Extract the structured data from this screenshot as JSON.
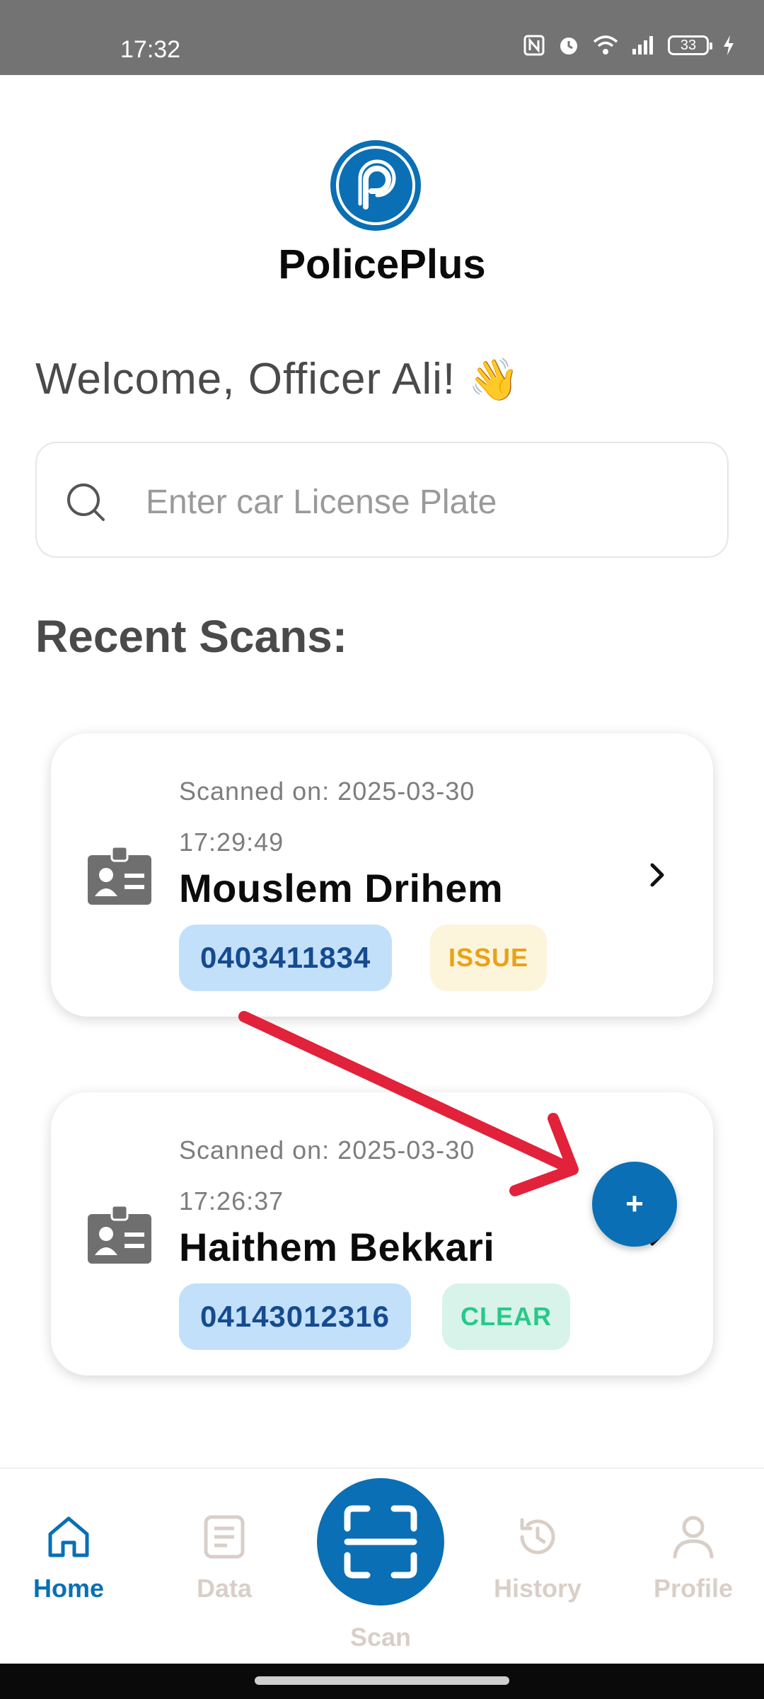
{
  "status_bar": {
    "time": "17:32",
    "battery": "33",
    "icons": [
      "nfc-icon",
      "alarm-icon",
      "wifi-icon",
      "signal-icon",
      "battery-icon",
      "charging-icon"
    ]
  },
  "app": {
    "name": "PolicePlus",
    "brand_color": "#0a6fb4"
  },
  "greeting": {
    "text": "Welcome, Officer Ali!",
    "emoji": "👋"
  },
  "search": {
    "placeholder": "Enter car License Plate",
    "value": ""
  },
  "recent": {
    "title": "Recent Scans:",
    "items": [
      {
        "date_label": "Scanned on: 2025-03-30 17:29:49",
        "name": "Mouslem Drihem",
        "id_number": "0403411834",
        "status": "ISSUE",
        "status_color": "#e8a215"
      },
      {
        "date_label": "Scanned on: 2025-03-30 17:26:37",
        "name": "Haithem Bekkari",
        "id_number": "04143012316",
        "status": "CLEAR",
        "status_color": "#27c98a"
      }
    ]
  },
  "fab": {
    "label": "+"
  },
  "annotation_arrow_color": "#e2213a",
  "nav": {
    "home": "Home",
    "data": "Data",
    "scan": "Scan",
    "history": "History",
    "profile": "Profile",
    "active": "home"
  }
}
